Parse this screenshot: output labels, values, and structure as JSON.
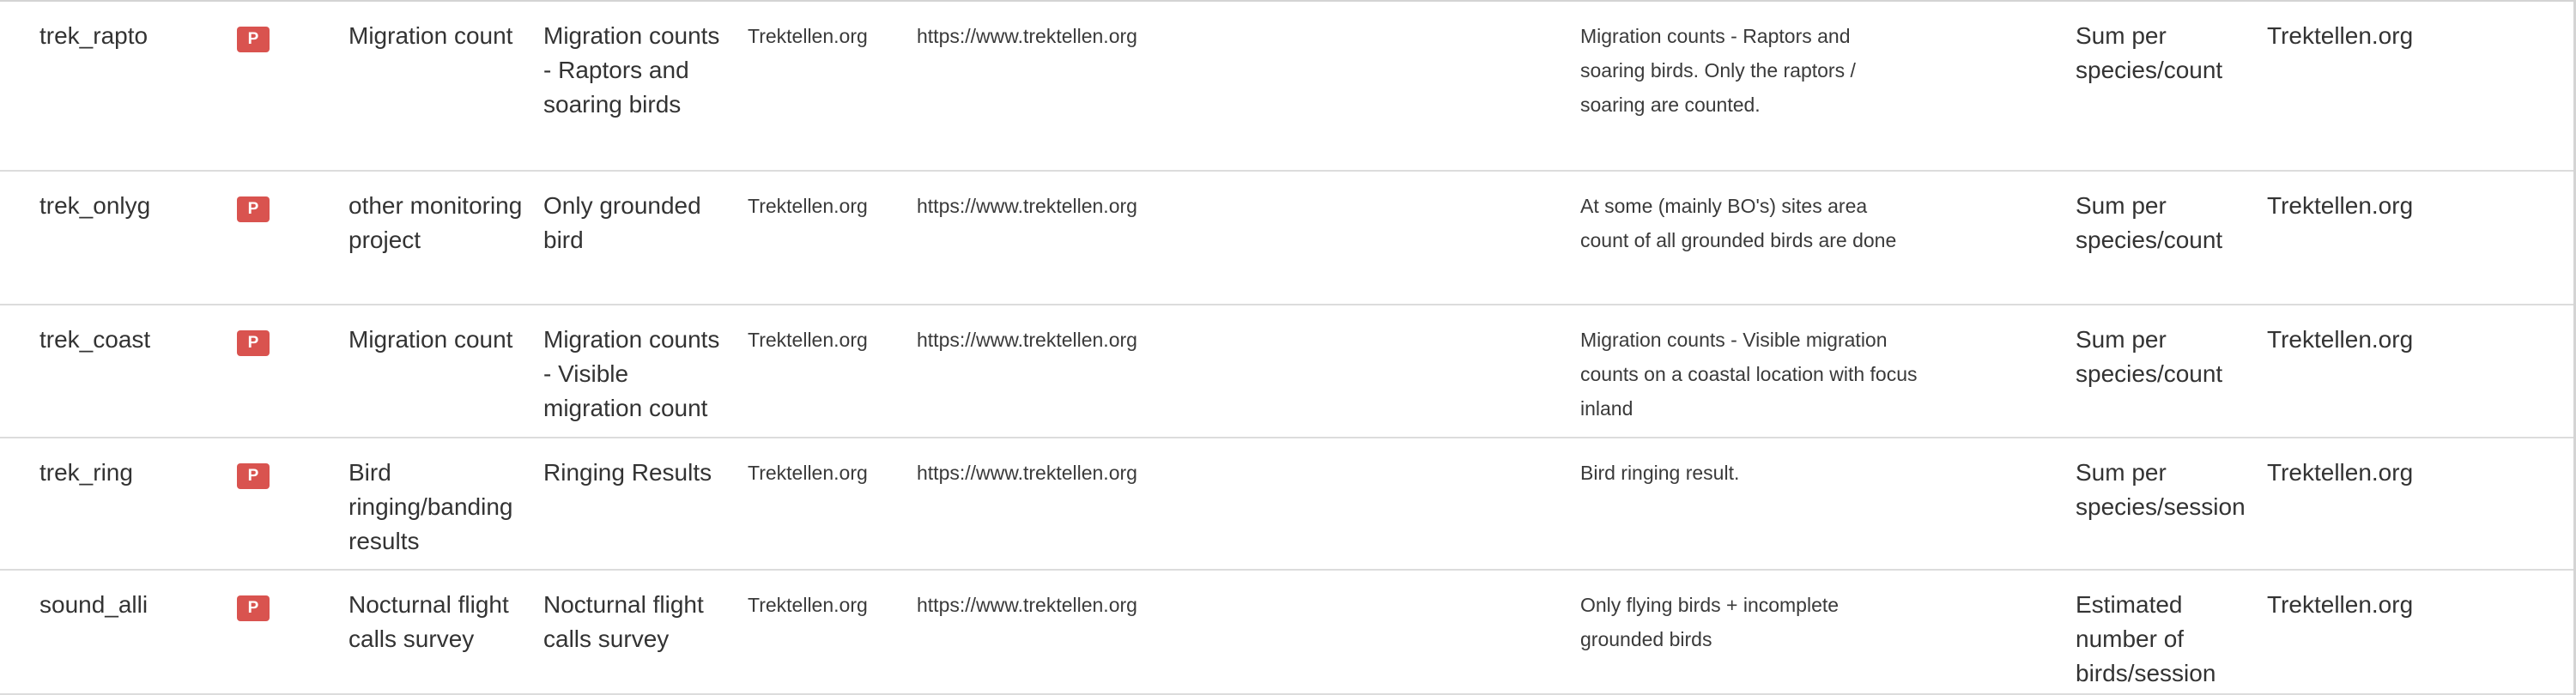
{
  "rows": [
    {
      "code": "trek_rapto",
      "badge": "P",
      "type": "Migration count",
      "name": "Migration counts - Raptors and soaring birds",
      "owner": "Trektellen.org",
      "url": "https://www.trektellen.org",
      "description": "Migration counts - Raptors and soaring birds. Only the raptors / soaring are counted.",
      "unit": "Sum per species/count",
      "provider": "Trektellen.org"
    },
    {
      "code": "trek_onlyg",
      "badge": "P",
      "type": "other monitoring project",
      "name": "Only grounded bird",
      "owner": "Trektellen.org",
      "url": "https://www.trektellen.org",
      "description": "At some (mainly BO's) sites area count of all grounded birds are done",
      "unit": "Sum per species/count",
      "provider": "Trektellen.org"
    },
    {
      "code": "trek_coast",
      "badge": "P",
      "type": "Migration count",
      "name": "Migration counts - Visible migration count",
      "owner": "Trektellen.org",
      "url": "https://www.trektellen.org",
      "description": "Migration counts - Visible migration counts on a coastal location with focus inland",
      "unit": "Sum per species/count",
      "provider": "Trektellen.org"
    },
    {
      "code": "trek_ring",
      "badge": "P",
      "type": "Bird ringing/banding results",
      "name": "Ringing Results",
      "owner": "Trektellen.org",
      "url": "https://www.trektellen.org",
      "description": "Bird ringing result.",
      "unit": "Sum per species/session",
      "provider": "Trektellen.org"
    },
    {
      "code": "sound_alli",
      "badge": "P",
      "type": "Nocturnal flight calls survey",
      "name": "Nocturnal flight calls survey",
      "owner": "Trektellen.org",
      "url": "https://www.trektellen.org",
      "description": "Only flying birds + incomplete grounded birds",
      "unit": "Estimated number of birds/session",
      "provider": "Trektellen.org"
    }
  ],
  "colors": {
    "badge_bg": "#d9534f",
    "text": "#333333",
    "row_border": "#dcdcdc"
  }
}
